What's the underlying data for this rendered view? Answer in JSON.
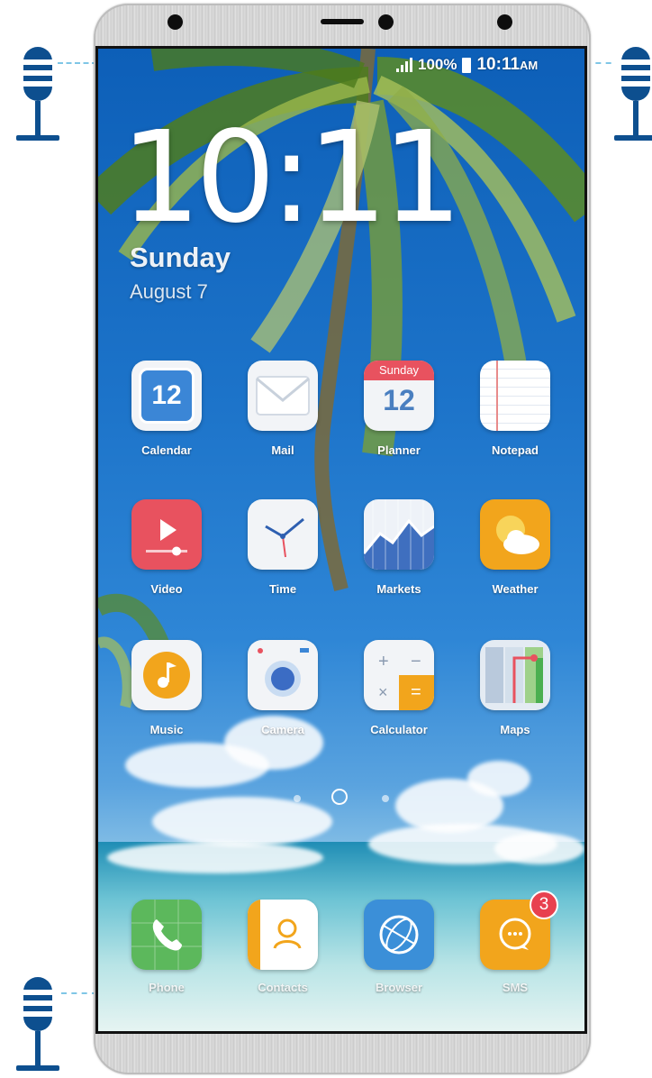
{
  "status_bar": {
    "battery_percent": "100%",
    "time": "10:11",
    "ampm": "AM"
  },
  "lock_clock": {
    "time": "10:11",
    "weekday": "Sunday",
    "date": "August 7"
  },
  "apps": [
    {
      "label": "Calendar",
      "icon": "calendar-icon",
      "icon_text": "12"
    },
    {
      "label": "Mail",
      "icon": "mail-icon"
    },
    {
      "label": "Planner",
      "icon": "planner-icon",
      "icon_header": "Sunday",
      "icon_text": "12"
    },
    {
      "label": "Notepad",
      "icon": "notepad-icon"
    },
    {
      "label": "Video",
      "icon": "video-icon"
    },
    {
      "label": "Time",
      "icon": "clock-icon"
    },
    {
      "label": "Markets",
      "icon": "markets-chart-icon"
    },
    {
      "label": "Weather",
      "icon": "weather-icon"
    },
    {
      "label": "Music",
      "icon": "music-note-icon"
    },
    {
      "label": "Camera",
      "icon": "camera-icon"
    },
    {
      "label": "Calculator",
      "icon": "calculator-icon"
    },
    {
      "label": "Maps",
      "icon": "map-icon"
    }
  ],
  "dock": [
    {
      "label": "Phone",
      "icon": "phone-icon"
    },
    {
      "label": "Contacts",
      "icon": "contacts-icon"
    },
    {
      "label": "Browser",
      "icon": "globe-icon"
    },
    {
      "label": "SMS",
      "icon": "chat-bubble-icon",
      "badge": "3"
    }
  ],
  "page_indicator": {
    "pages": 3,
    "current": 2
  },
  "colors": {
    "mic": "#0d4f8f",
    "badge": "#e8414f"
  }
}
